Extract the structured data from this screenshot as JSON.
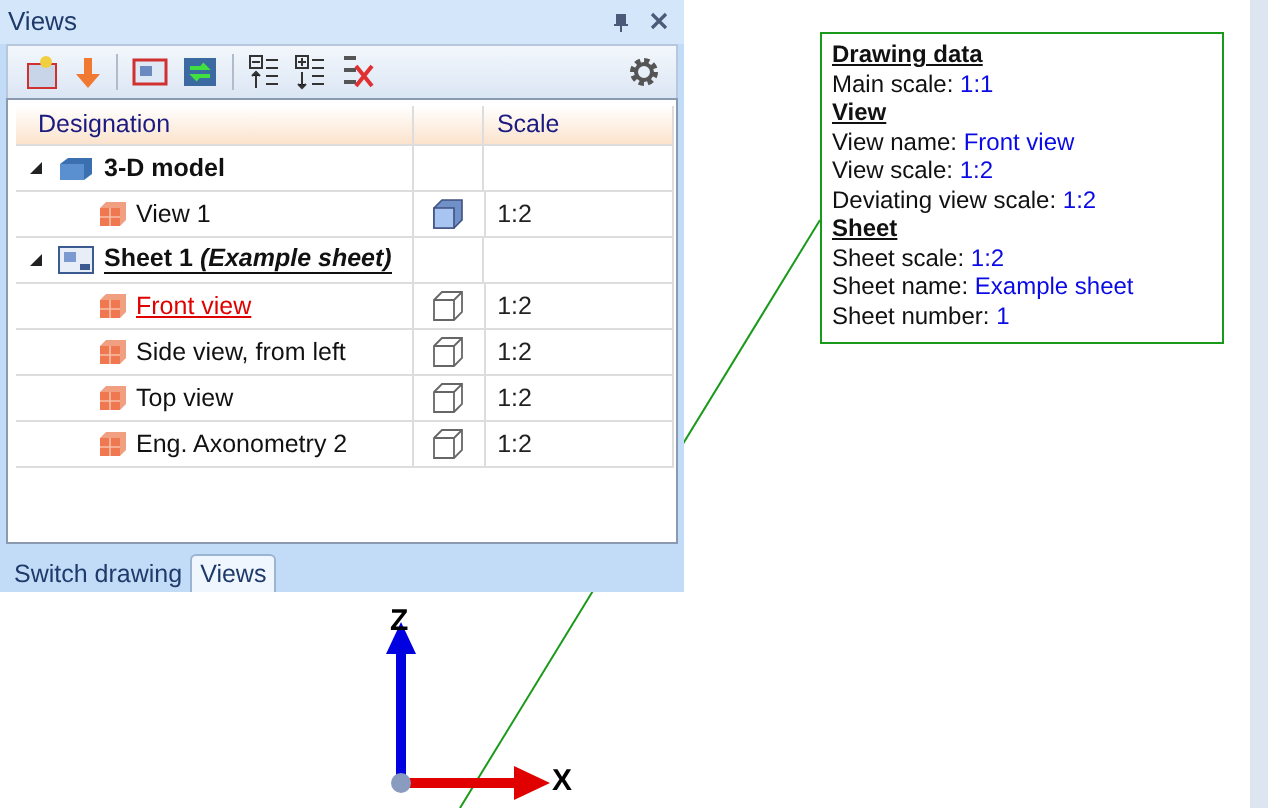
{
  "panel": {
    "title": "Views",
    "columns": [
      "Designation",
      "",
      "Scale"
    ],
    "tree": [
      {
        "kind": "model",
        "label": "3-D model",
        "expanded": true,
        "selected": false,
        "children": [
          {
            "kind": "view",
            "label": "View 1",
            "shaded": true,
            "scale": "1:2",
            "selected": false
          }
        ]
      },
      {
        "kind": "sheet",
        "label": "Sheet 1 *(Example sheet)*",
        "expanded": true,
        "selected": false,
        "children": [
          {
            "kind": "view",
            "label": "Front view",
            "shaded": false,
            "scale": "1:2",
            "selected": true
          },
          {
            "kind": "view",
            "label": "Side view, from left",
            "shaded": false,
            "scale": "1:2",
            "selected": false
          },
          {
            "kind": "view",
            "label": "Top view",
            "shaded": false,
            "scale": "1:2",
            "selected": false
          },
          {
            "kind": "view",
            "label": "Eng. Axonometry 2",
            "shaded": false,
            "scale": "1:2",
            "selected": false
          }
        ]
      }
    ],
    "tabs": [
      {
        "label": "Switch drawing",
        "selected": false
      },
      {
        "label": "Views",
        "selected": true
      }
    ]
  },
  "info": {
    "sections": [
      {
        "heading": "Drawing data",
        "lines": [
          {
            "label": "Main scale:",
            "value": "1:1"
          }
        ]
      },
      {
        "heading": "View",
        "lines": [
          {
            "label": "View name:",
            "value": "Front view"
          },
          {
            "label": "View scale:",
            "value": "1:2"
          },
          {
            "label": "Deviating view scale:",
            "value": "1:2"
          }
        ]
      },
      {
        "heading": "Sheet",
        "lines": [
          {
            "label": "Sheet scale:",
            "value": "1:2"
          },
          {
            "label": "Sheet name:",
            "value": "Example sheet"
          },
          {
            "label": "Sheet number:",
            "value": "1"
          }
        ]
      }
    ]
  },
  "axes": {
    "vertical": "Z",
    "horizontal": "X"
  }
}
